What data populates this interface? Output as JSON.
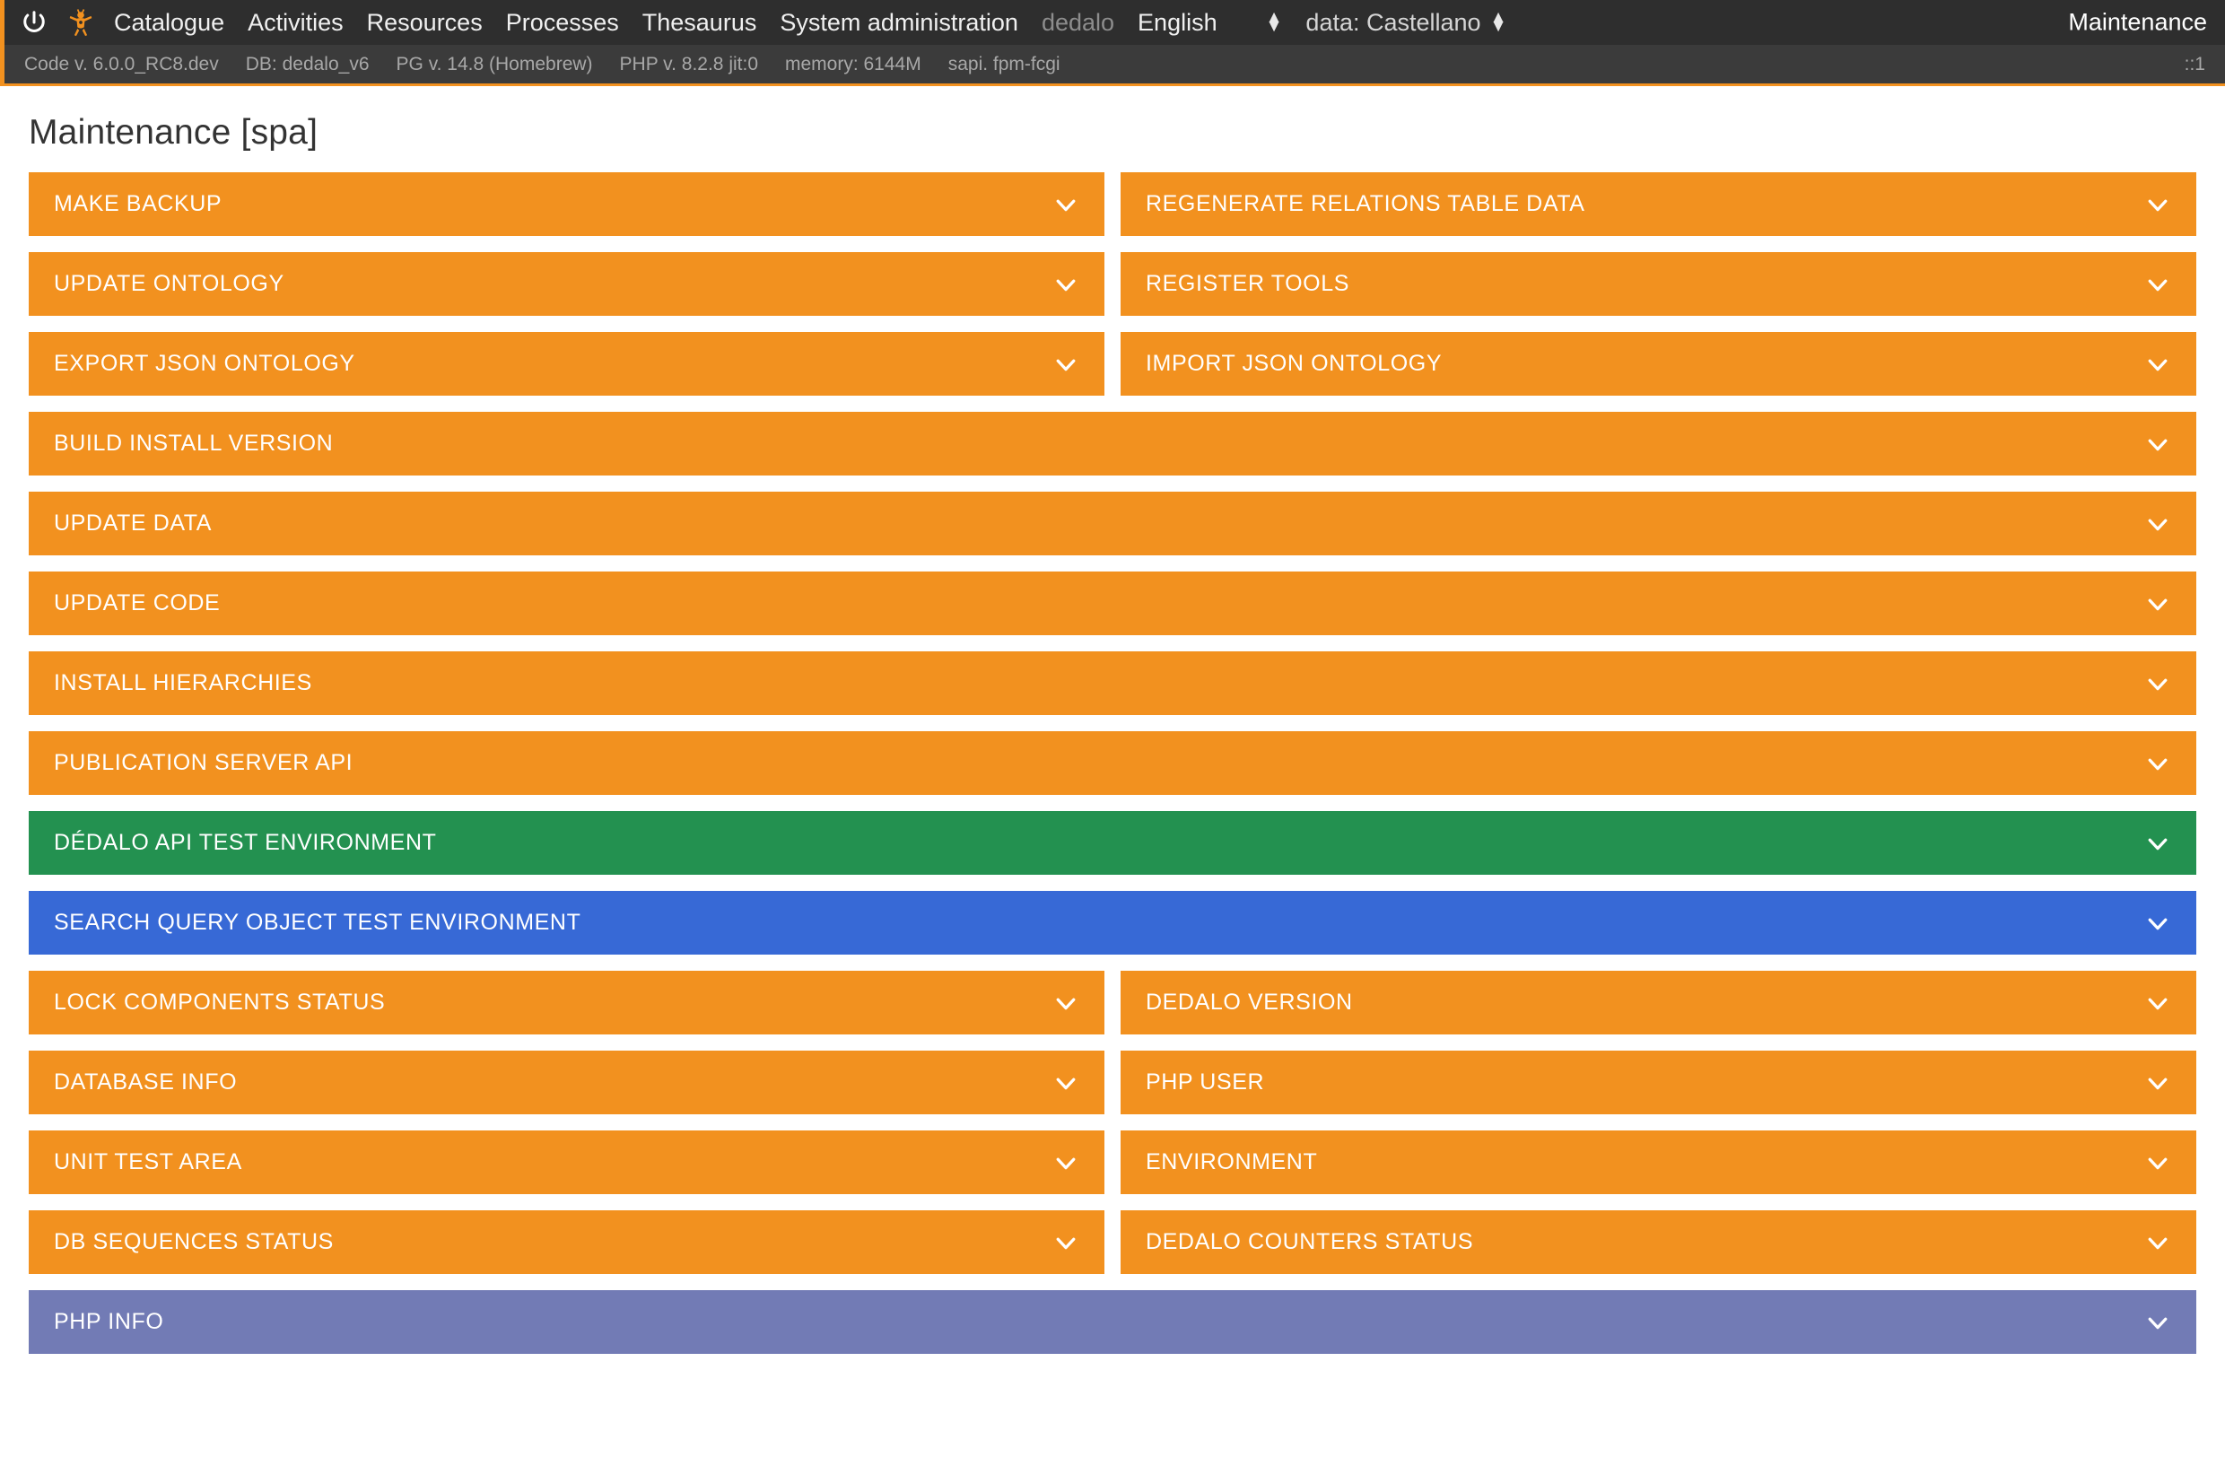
{
  "top_bar": {
    "power_icon": "power-icon",
    "logo_icon": "dedalo-logo-icon",
    "menu": [
      {
        "label": "Catalogue",
        "dim": false
      },
      {
        "label": "Activities",
        "dim": false
      },
      {
        "label": "Resources",
        "dim": false
      },
      {
        "label": "Processes",
        "dim": false
      },
      {
        "label": "Thesaurus",
        "dim": false
      },
      {
        "label": "System administration",
        "dim": false
      },
      {
        "label": "dedalo",
        "dim": true
      }
    ],
    "language_select": {
      "value": "English",
      "arrows_icon": "updown-arrows-icon"
    },
    "data_select": {
      "value": "data: Castellano",
      "arrows_icon": "updown-arrows-icon"
    },
    "page_flag": "Maintenance"
  },
  "info_bar": {
    "items": [
      "Code v. 6.0.0_RC8.dev",
      "DB: dedalo_v6",
      "PG v. 14.8 (Homebrew)",
      "PHP v. 8.2.8 jit:0",
      "memory: 6144M",
      "sapi. fpm-fcgi"
    ],
    "ip": "::1"
  },
  "page": {
    "title": "Maintenance [spa]"
  },
  "colors": {
    "orange": "#f2911f",
    "green": "#239150",
    "blue": "#3769d6",
    "purple": "#727bb5",
    "dark_nav": "#2e2e2e",
    "info_bar": "#3b3b3b"
  },
  "sections": [
    {
      "layout": "pair",
      "items": [
        {
          "label": "MAKE BACKUP",
          "color": "orange",
          "chevron": "chevron-down-icon"
        },
        {
          "label": "REGENERATE RELATIONS TABLE DATA",
          "color": "orange",
          "chevron": "chevron-down-icon"
        }
      ]
    },
    {
      "layout": "pair",
      "items": [
        {
          "label": "UPDATE ONTOLOGY",
          "color": "orange",
          "chevron": "chevron-down-icon"
        },
        {
          "label": "REGISTER TOOLS",
          "color": "orange",
          "chevron": "chevron-down-icon"
        }
      ]
    },
    {
      "layout": "pair",
      "items": [
        {
          "label": "EXPORT JSON ONTOLOGY",
          "color": "orange",
          "chevron": "chevron-down-icon"
        },
        {
          "label": "IMPORT JSON ONTOLOGY",
          "color": "orange",
          "chevron": "chevron-down-icon"
        }
      ]
    },
    {
      "layout": "full",
      "items": [
        {
          "label": "BUILD INSTALL VERSION",
          "color": "orange",
          "chevron": "chevron-down-icon"
        }
      ]
    },
    {
      "layout": "full",
      "items": [
        {
          "label": "UPDATE DATA",
          "color": "orange",
          "chevron": "chevron-down-icon"
        }
      ]
    },
    {
      "layout": "full",
      "items": [
        {
          "label": "UPDATE CODE",
          "color": "orange",
          "chevron": "chevron-down-icon"
        }
      ]
    },
    {
      "layout": "full",
      "items": [
        {
          "label": "INSTALL HIERARCHIES",
          "color": "orange",
          "chevron": "chevron-down-icon"
        }
      ]
    },
    {
      "layout": "full",
      "items": [
        {
          "label": "PUBLICATION SERVER API",
          "color": "orange",
          "chevron": "chevron-down-icon"
        }
      ]
    },
    {
      "layout": "full",
      "items": [
        {
          "label": "DÉDALO API TEST ENVIRONMENT",
          "color": "green",
          "chevron": "chevron-down-icon"
        }
      ]
    },
    {
      "layout": "full",
      "items": [
        {
          "label": "SEARCH QUERY OBJECT TEST ENVIRONMENT",
          "color": "blue",
          "chevron": "chevron-down-icon"
        }
      ]
    },
    {
      "layout": "pair",
      "items": [
        {
          "label": "LOCK COMPONENTS STATUS",
          "color": "orange",
          "chevron": "chevron-down-icon"
        },
        {
          "label": "DEDALO VERSION",
          "color": "orange",
          "chevron": "chevron-down-icon"
        }
      ]
    },
    {
      "layout": "pair",
      "items": [
        {
          "label": "DATABASE INFO",
          "color": "orange",
          "chevron": "chevron-down-icon"
        },
        {
          "label": "PHP USER",
          "color": "orange",
          "chevron": "chevron-down-icon"
        }
      ]
    },
    {
      "layout": "pair",
      "items": [
        {
          "label": "UNIT TEST AREA",
          "color": "orange",
          "chevron": "chevron-down-icon"
        },
        {
          "label": "ENVIRONMENT",
          "color": "orange",
          "chevron": "chevron-down-icon"
        }
      ]
    },
    {
      "layout": "pair",
      "items": [
        {
          "label": "DB SEQUENCES STATUS",
          "color": "orange",
          "chevron": "chevron-down-icon"
        },
        {
          "label": "DEDALO COUNTERS STATUS",
          "color": "orange",
          "chevron": "chevron-down-icon"
        }
      ]
    },
    {
      "layout": "full",
      "items": [
        {
          "label": "PHP INFO",
          "color": "purple",
          "chevron": "chevron-down-icon"
        }
      ]
    }
  ]
}
